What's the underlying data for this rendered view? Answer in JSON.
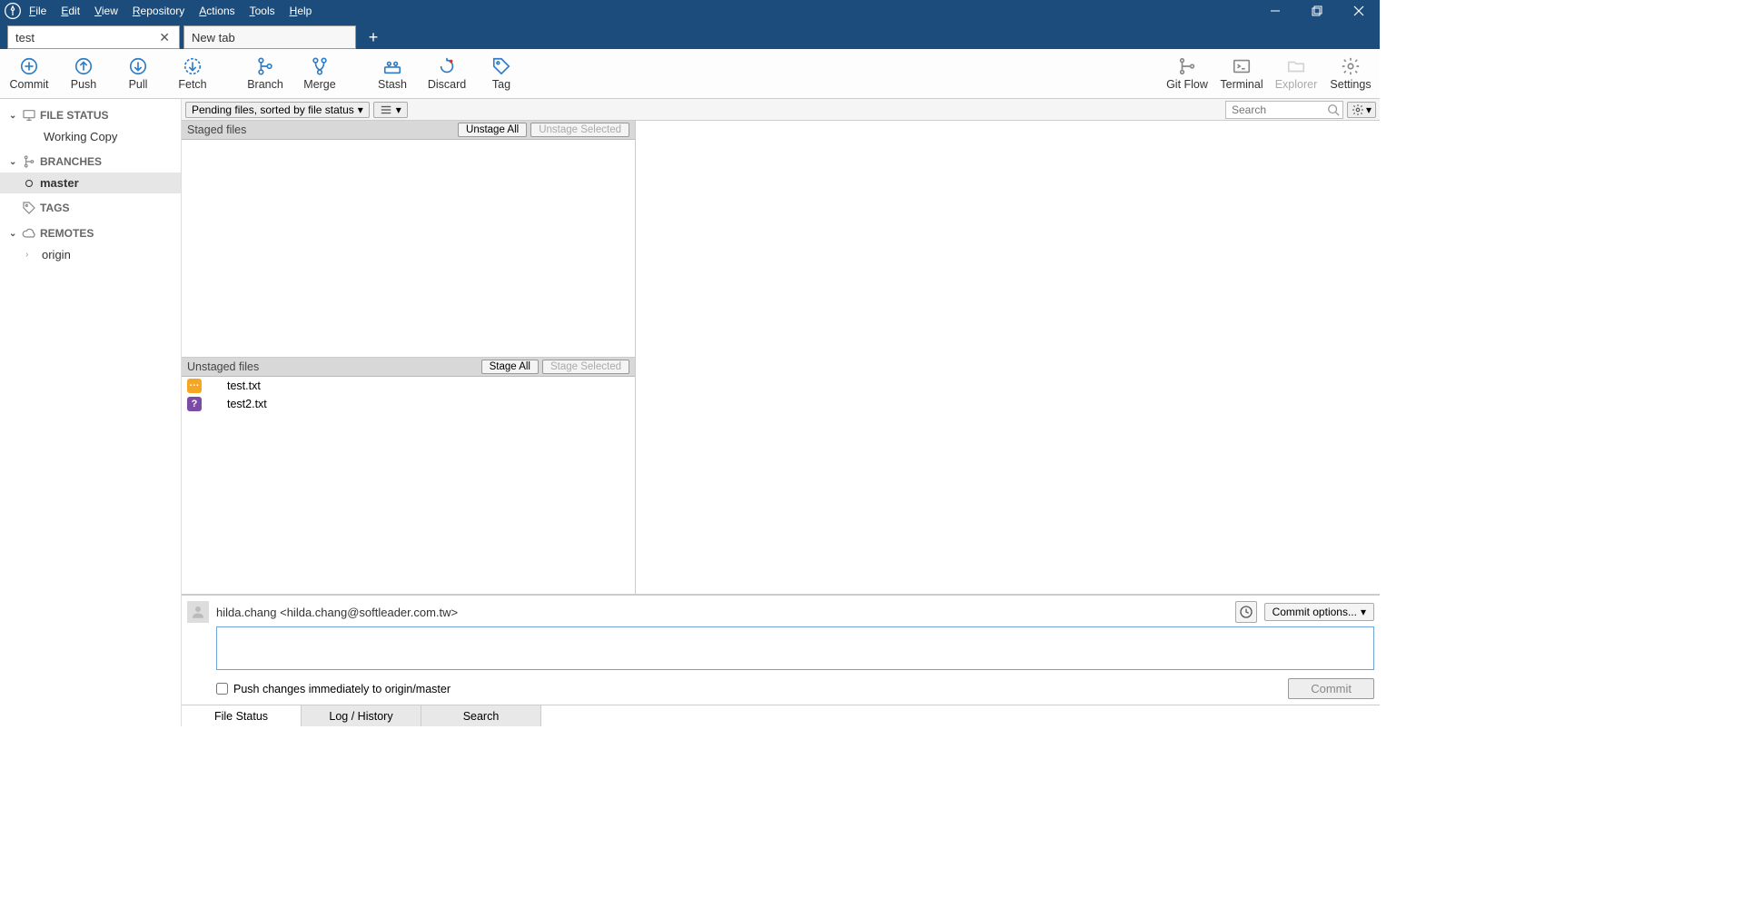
{
  "menu": {
    "file": "File",
    "edit": "Edit",
    "view": "View",
    "repository": "Repository",
    "actions": "Actions",
    "tools": "Tools",
    "help": "Help"
  },
  "tabs": {
    "active": "test",
    "second": "New tab"
  },
  "toolbar": {
    "commit": "Commit",
    "push": "Push",
    "pull": "Pull",
    "fetch": "Fetch",
    "branch": "Branch",
    "merge": "Merge",
    "stash": "Stash",
    "discard": "Discard",
    "tag": "Tag",
    "gitflow": "Git Flow",
    "terminal": "Terminal",
    "explorer": "Explorer",
    "settings": "Settings"
  },
  "sidebar": {
    "file_status": "FILE STATUS",
    "working_copy": "Working Copy",
    "branches": "BRANCHES",
    "master": "master",
    "tags": "TAGS",
    "remotes": "REMOTES",
    "origin": "origin"
  },
  "filter": {
    "pending": "Pending files, sorted by file status",
    "search_placeholder": "Search"
  },
  "staged": {
    "title": "Staged files",
    "unstage_all": "Unstage All",
    "unstage_selected": "Unstage Selected"
  },
  "unstaged": {
    "title": "Unstaged files",
    "stage_all": "Stage All",
    "stage_selected": "Stage Selected",
    "files": [
      {
        "name": "test.txt",
        "status": "modified",
        "glyph": "···"
      },
      {
        "name": "test2.txt",
        "status": "unknown",
        "glyph": "?"
      }
    ]
  },
  "commit": {
    "author": "hilda.chang <hilda.chang@softleader.com.tw>",
    "options": "Commit options...",
    "push_immediately": "Push changes immediately to origin/master",
    "commit_btn": "Commit"
  },
  "bottom_tabs": {
    "file_status": "File Status",
    "log": "Log / History",
    "search": "Search"
  }
}
